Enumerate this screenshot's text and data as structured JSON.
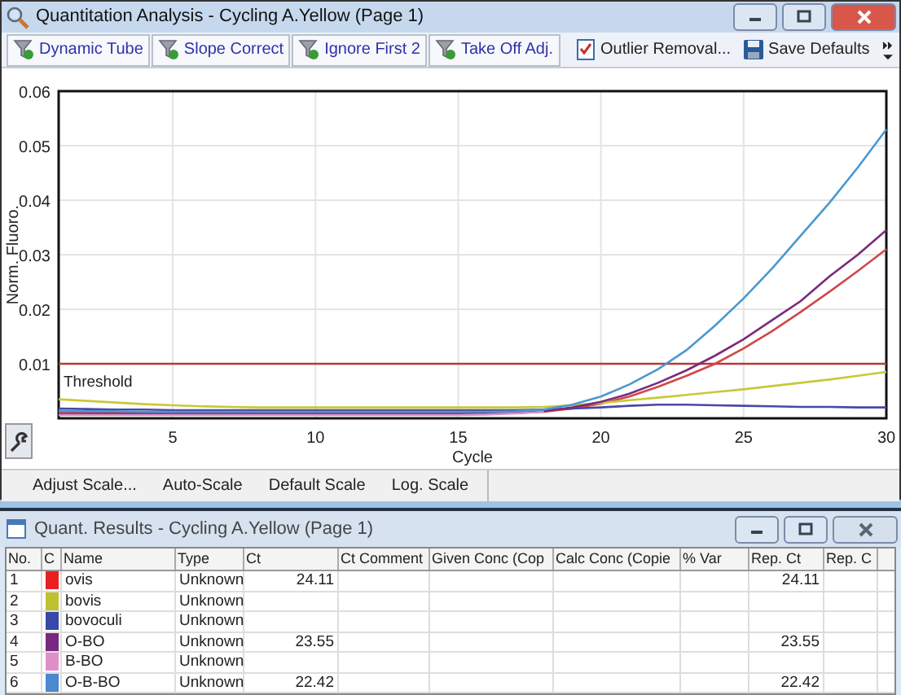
{
  "analysis_window": {
    "title": "Quantitation Analysis - Cycling A.Yellow (Page 1)",
    "toolbar": [
      {
        "kind": "toggle",
        "label": "Dynamic Tube",
        "on": true
      },
      {
        "kind": "toggle",
        "label": "Slope Correct",
        "on": true
      },
      {
        "kind": "toggle",
        "label": "Ignore First 2",
        "on": true
      },
      {
        "kind": "toggle",
        "label": "Take Off Adj.",
        "on": true
      },
      {
        "kind": "outlier",
        "label": "Outlier Removal..."
      },
      {
        "kind": "save",
        "label": "Save Defaults"
      }
    ],
    "chart": {
      "chart_data": {
        "type": "line",
        "xlabel": "Cycle",
        "ylabel": "Norm. Fluoro.",
        "x": [
          1,
          2,
          3,
          4,
          5,
          6,
          7,
          8,
          9,
          10,
          11,
          12,
          13,
          14,
          15,
          16,
          17,
          18,
          19,
          20,
          21,
          22,
          23,
          24,
          25,
          26,
          27,
          28,
          29,
          30
        ],
        "xlim": [
          1,
          30
        ],
        "ylim": [
          0,
          0.06
        ],
        "xticks": [
          5,
          10,
          15,
          20,
          25,
          30
        ],
        "yticks": [
          0.01,
          0.02,
          0.03,
          0.04,
          0.05,
          0.06
        ],
        "series": [
          {
            "color": "#d04848",
            "values": [
              0.0012,
              0.0011,
              0.001,
              0.001,
              0.0009,
              0.0009,
              0.0009,
              0.0009,
              0.0009,
              0.0009,
              0.0009,
              0.0009,
              0.0009,
              0.0009,
              0.0009,
              0.0009,
              0.001,
              0.0012,
              0.0018,
              0.0027,
              0.004,
              0.0058,
              0.0078,
              0.01,
              0.0128,
              0.016,
              0.0195,
              0.0232,
              0.027,
              0.031
            ]
          },
          {
            "color": "#c8c838",
            "values": [
              0.0035,
              0.0032,
              0.0029,
              0.0026,
              0.0024,
              0.0022,
              0.0021,
              0.002,
              0.002,
              0.002,
              0.002,
              0.002,
              0.002,
              0.002,
              0.002,
              0.002,
              0.002,
              0.0021,
              0.0024,
              0.0028,
              0.0033,
              0.0038,
              0.0043,
              0.0048,
              0.0053,
              0.0059,
              0.0065,
              0.0071,
              0.0078,
              0.0085
            ]
          },
          {
            "color": "#4848a8",
            "values": [
              0.0018,
              0.0017,
              0.0016,
              0.0016,
              0.0015,
              0.0015,
              0.0015,
              0.0015,
              0.0015,
              0.0015,
              0.0015,
              0.0015,
              0.0015,
              0.0015,
              0.0015,
              0.0015,
              0.0015,
              0.0016,
              0.0018,
              0.002,
              0.0023,
              0.0025,
              0.0025,
              0.0024,
              0.0023,
              0.0022,
              0.0021,
              0.0021,
              0.002,
              0.002
            ]
          },
          {
            "color": "#7a2a7a",
            "values": [
              0.0008,
              0.0008,
              0.0008,
              0.0008,
              0.0008,
              0.0008,
              0.0008,
              0.0008,
              0.0008,
              0.0008,
              0.0008,
              0.0008,
              0.0008,
              0.0008,
              0.0008,
              0.0009,
              0.001,
              0.0013,
              0.002,
              0.003,
              0.0045,
              0.0065,
              0.0088,
              0.0115,
              0.0145,
              0.018,
              0.0215,
              0.026,
              0.03,
              0.0345
            ]
          },
          {
            "color": "#d890c8",
            "values": [
              0.0006,
              0.0006,
              0.0006,
              0.0006,
              0.0006,
              0.0006,
              0.0006,
              0.0006,
              0.0006,
              0.0006,
              0.0006,
              0.0006,
              0.0006,
              0.0006,
              0.0006,
              0.0007,
              0.0009,
              0.0012,
              null,
              null,
              null,
              null,
              null,
              null,
              null,
              null,
              null,
              null,
              null,
              null
            ]
          },
          {
            "color": "#4a98d0",
            "values": [
              0.0014,
              0.0013,
              0.0013,
              0.0012,
              0.0012,
              0.0012,
              0.0012,
              0.0012,
              0.0012,
              0.0012,
              0.0012,
              0.0012,
              0.0012,
              0.0012,
              0.0012,
              0.0012,
              0.0013,
              0.0016,
              0.0025,
              0.004,
              0.0062,
              0.009,
              0.0125,
              0.017,
              0.022,
              0.0275,
              0.0335,
              0.0395,
              0.046,
              0.053
            ]
          }
        ],
        "grid": true,
        "ref_lines": [
          {
            "axis": "y",
            "value": 0.01,
            "label": "Threshold"
          }
        ]
      }
    },
    "scale_buttons": [
      "Adjust Scale...",
      "Auto-Scale",
      "Default Scale",
      "Log. Scale"
    ]
  },
  "results_window": {
    "title": "Quant. Results - Cycling A.Yellow (Page 1)",
    "table": {
      "columns": [
        "No.",
        "C",
        "Name",
        "Type",
        "Ct",
        "Ct Comment",
        "Given Conc (Cop",
        "Calc Conc (Copie",
        "% Var",
        "Rep. Ct",
        "Rep. C"
      ],
      "rows": [
        {
          "no": "1",
          "color": "#e82020",
          "name": "ovis",
          "type": "Unknown",
          "ct": "24.11",
          "rep_ct": "24.11"
        },
        {
          "no": "2",
          "color": "#c0c030",
          "name": "bovis",
          "type": "Unknown"
        },
        {
          "no": "3",
          "color": "#3848a8",
          "name": "bovoculi",
          "type": "Unknown"
        },
        {
          "no": "4",
          "color": "#782880",
          "name": "O-BO",
          "type": "Unknown",
          "ct": "23.55",
          "rep_ct": "23.55"
        },
        {
          "no": "5",
          "color": "#e090c8",
          "name": "B-BO",
          "type": "Unknown"
        },
        {
          "no": "6",
          "color": "#4a88d0",
          "name": "O-B-BO",
          "type": "Unknown",
          "ct": "22.42",
          "rep_ct": "22.42"
        }
      ]
    }
  }
}
